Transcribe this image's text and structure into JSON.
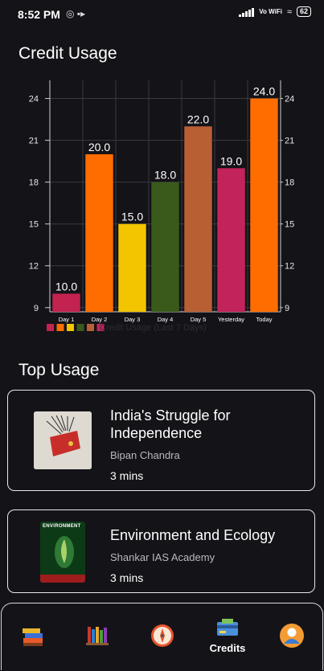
{
  "status_bar": {
    "time": "8:52 PM",
    "network": "Vo WiFi",
    "battery": "62",
    "icons": [
      "whatsapp-icon",
      "video-icon",
      "signal-icon",
      "wifi-icon",
      "battery-icon"
    ]
  },
  "credit_usage": {
    "title": "Credit Usage"
  },
  "chart_data": {
    "type": "bar",
    "categories": [
      "Day 1",
      "Day 2",
      "Day 3",
      "Day 4",
      "Day 5",
      "Yesterday",
      "Today"
    ],
    "values": [
      10,
      20,
      15,
      18,
      22,
      19,
      24
    ],
    "value_labels": [
      "10.0",
      "20.0",
      "15.0",
      "18.0",
      "22.0",
      "19.0",
      "24.0"
    ],
    "colors": [
      "#c2234f",
      "#ff6d00",
      "#f2c500",
      "#3a5a1c",
      "#b85f34",
      "#c2235a",
      "#ff6d00"
    ],
    "ylim": [
      8.7,
      25.3
    ],
    "yticks": [
      9,
      12,
      15,
      18,
      21,
      24
    ],
    "grid": true,
    "legend": "Credit Usage (Last 7 Days)",
    "legend_placement": "bottom-left",
    "dual_y_axis": true
  },
  "top_usage": {
    "title": "Top Usage",
    "items": [
      {
        "title": "India's Struggle for Independence",
        "author": "Bipan Chandra",
        "time": "3 mins",
        "cover_text": ""
      },
      {
        "title": "Environment and Ecology",
        "author": "Shankar IAS Academy",
        "time": "3 mins",
        "cover_text": "ENVIRONMENT"
      }
    ]
  },
  "bottom_nav": {
    "items": [
      {
        "name": "books",
        "icon": "books-stack-icon",
        "label": ""
      },
      {
        "name": "library",
        "icon": "bookshelf-icon",
        "label": ""
      },
      {
        "name": "explore",
        "icon": "compass-icon",
        "label": ""
      },
      {
        "name": "credits",
        "icon": "credit-card-icon",
        "label": "Credits",
        "active": true
      },
      {
        "name": "profile",
        "icon": "avatar-icon",
        "label": ""
      }
    ]
  }
}
